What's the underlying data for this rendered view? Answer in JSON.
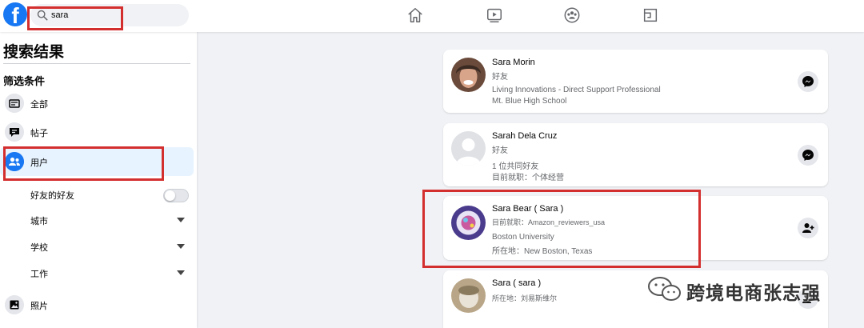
{
  "header": {
    "logo": "f",
    "search": {
      "value": "sara",
      "placeholder": ""
    },
    "nav_icons": [
      "home-icon",
      "watch-icon",
      "groups-icon",
      "gaming-icon"
    ]
  },
  "sidebar": {
    "title": "搜索结果",
    "filters_label": "筛选条件",
    "items": [
      {
        "label": "全部",
        "icon": "all-results-icon"
      },
      {
        "label": "帖子",
        "icon": "posts-icon"
      },
      {
        "label": "用户",
        "icon": "people-icon",
        "active": true
      },
      {
        "label": "照片",
        "icon": "photos-icon"
      }
    ],
    "sub_filters": {
      "friends_of_friends": "好友的好友",
      "city": "城市",
      "school": "学校",
      "work": "工作"
    }
  },
  "results": [
    {
      "name": "Sara Morin",
      "lines": [
        "好友",
        "Living Innovations - Direct Support Professional",
        "Mt. Blue High School"
      ],
      "action": "messenger-icon"
    },
    {
      "name": "Sarah Dela Cruz",
      "lines": [
        "好友",
        "1 位共同好友",
        "目前就职：个体经营"
      ],
      "action": "messenger-icon"
    },
    {
      "name": "Sara Bear ( Sara )",
      "lines": [
        "目前就职：Amazon_reviewers_usa",
        "Boston University",
        "所在地：New Boston, Texas"
      ],
      "action": "add-friend-icon"
    },
    {
      "name": "Sara ( sara )",
      "lines": [
        "所在地：刘易斯维尔"
      ],
      "action": "add-friend-icon"
    }
  ],
  "watermark": "跨境电商张志强",
  "colors": {
    "brand": "#1877f2",
    "highlight": "#d32f2f",
    "active_bg": "#e7f3ff"
  }
}
